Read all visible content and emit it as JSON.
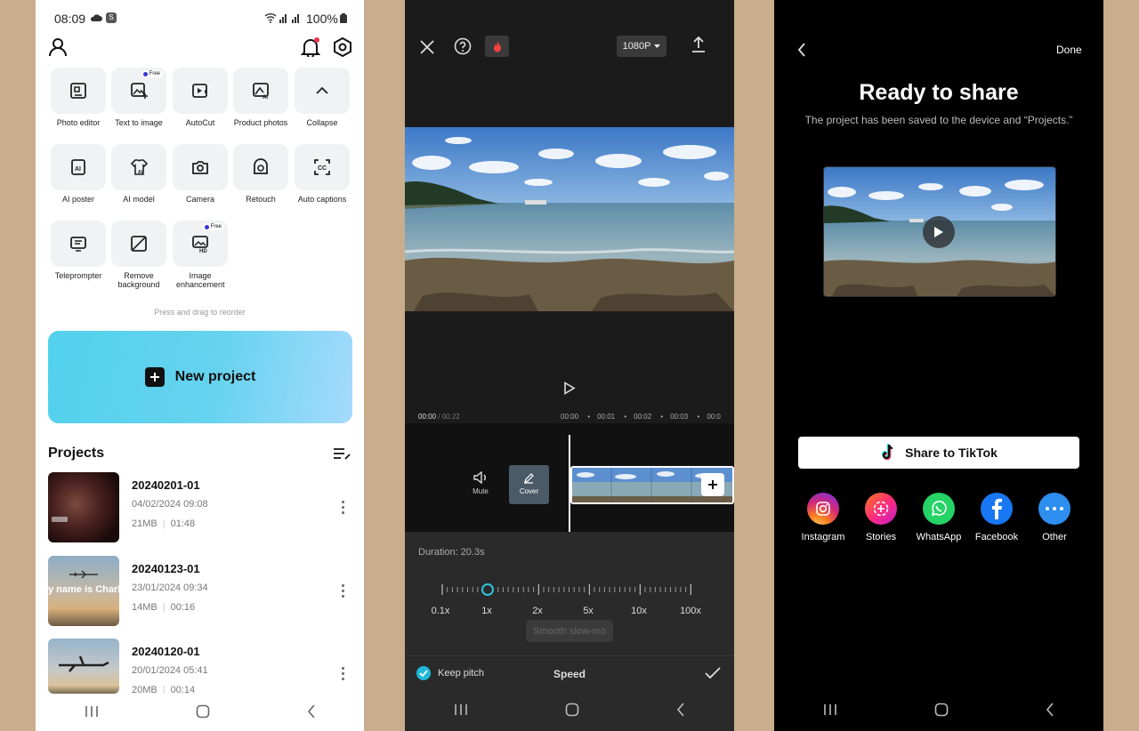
{
  "panel1": {
    "status": {
      "time": "08:09",
      "battery": "100%"
    },
    "tools": [
      {
        "label": "Photo editor",
        "free": false
      },
      {
        "label": "Text to image",
        "free": true
      },
      {
        "label": "AutoCut",
        "free": false
      },
      {
        "label": "Product photos",
        "free": false
      },
      {
        "label": "Collapse",
        "free": false
      },
      {
        "label": "AI poster",
        "free": false
      },
      {
        "label": "AI model",
        "free": false
      },
      {
        "label": "Camera",
        "free": false
      },
      {
        "label": "Retouch",
        "free": false
      },
      {
        "label": "Auto captions",
        "free": false
      },
      {
        "label": "Teleprompter",
        "free": false
      },
      {
        "label": "Remove background",
        "free": false
      },
      {
        "label": "Image enhancement",
        "free": true
      }
    ],
    "free_badge": "Free",
    "reorder_hint": "Press and drag to reorder",
    "new_project": "New project",
    "projects_title": "Projects",
    "projects": [
      {
        "name": "20240201-01",
        "date": "04/02/2024 09:08",
        "size": "21MB",
        "duration": "01:48"
      },
      {
        "name": "20240123-01",
        "date": "23/01/2024 09:34",
        "size": "14MB",
        "duration": "00:16",
        "thumb_text": "y name is Charl"
      },
      {
        "name": "20240120-01",
        "date": "20/01/2024 05:41",
        "size": "20MB",
        "duration": "00:14"
      }
    ]
  },
  "panel2": {
    "resolution": "1080P",
    "current_time": "00:00",
    "total_time": "/ 00:22",
    "ruler": [
      "00:00",
      "00:01",
      "00:02",
      "00:03",
      "00:0"
    ],
    "mute_label": "Mute",
    "cover_label": "Cover",
    "duration_label": "Duration:  20.3s",
    "speed_marks": [
      "0.1x",
      "1x",
      "2x",
      "5x",
      "10x",
      "100x"
    ],
    "current_speed": "1x",
    "smooth_label": "Smooth slow-mo",
    "keep_pitch": "Keep pitch",
    "keep_pitch_checked": true,
    "title": "Speed"
  },
  "panel3": {
    "done": "Done",
    "title": "Ready to share",
    "subtitle": "The project has been saved to the device and “Projects.”",
    "tiktok_button": "Share to TikTok",
    "share_targets": [
      {
        "label": "Instagram",
        "color": "#e1306c"
      },
      {
        "label": "Stories",
        "color": "#ff2d7a"
      },
      {
        "label": "WhatsApp",
        "color": "#25d366"
      },
      {
        "label": "Facebook",
        "color": "#1877f2"
      },
      {
        "label": "Other",
        "color": "#2d8ef0"
      }
    ]
  },
  "colors": {
    "accent": "#1fb8d8",
    "page_bg": "#c9ad8c"
  }
}
